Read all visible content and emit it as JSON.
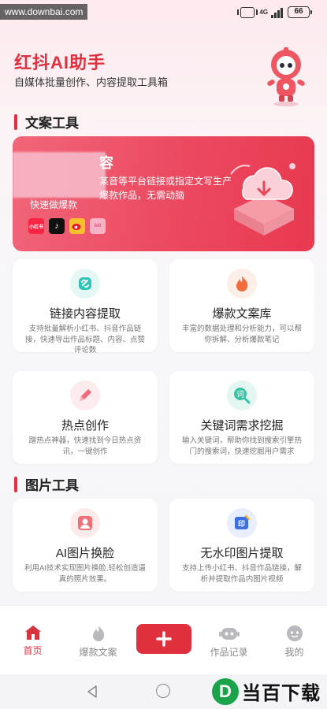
{
  "status": {
    "watermark": "www.downbai.com",
    "network": "4G",
    "battery": "66"
  },
  "header": {
    "title": "红抖AI助手",
    "subtitle": "自媒体批量创作、内容提取工具箱"
  },
  "sections": {
    "copy_tools": "文案工具",
    "image_tools": "图片工具"
  },
  "banner": {
    "title": "容",
    "desc": "某音等平台链接或指定文写生产爆款作品，无需动脑",
    "sub": "快速做爆款",
    "platforms": [
      "小红书",
      "♪",
      "",
      "bili"
    ]
  },
  "cards": [
    {
      "title": "链接内容提取",
      "desc": "支持批量解析小红书、抖音作品链接，快速导出作品标题、内容、点赞评论数",
      "icon": "link-icon",
      "color": "#2ec4b6"
    },
    {
      "title": "爆款文案库",
      "desc": "丰富的数据处理和分析能力，可以帮你拆解、分析爆款笔记",
      "icon": "flame-icon",
      "color": "#f26b3a"
    },
    {
      "title": "热点创作",
      "desc": "蹭热点神器，快速找到今日热点资讯，一键创作",
      "icon": "pencil-icon",
      "color": "#f06a7a"
    },
    {
      "title": "关键词需求挖掘",
      "desc": "输入关键词，帮助你找到搜索引擎热门的搜索词，快速挖掘用户需求",
      "icon": "keyword-search-icon",
      "color": "#35c2a5"
    },
    {
      "title": "AI图片换脸",
      "desc": "利用AI技术实现图片换脸,轻松创造逼真的照片效果。",
      "icon": "face-swap-icon",
      "color": "#f07078"
    },
    {
      "title": "无水印图片提取",
      "desc": "支持上传小红书、抖音作品链接，解析并提取作品内图片视频",
      "icon": "watermark-remove-icon",
      "color": "#3d6fe0"
    }
  ],
  "nav": {
    "home": "首页",
    "hot_copy": "爆款文案",
    "works": "作品记录",
    "mine": "我的",
    "accent": "#e0303e"
  },
  "footer_brand": {
    "logo": "D",
    "text": "当百下载"
  }
}
